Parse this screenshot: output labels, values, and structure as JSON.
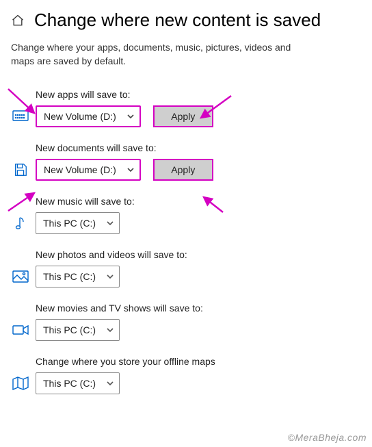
{
  "header": {
    "title": "Change where new content is saved"
  },
  "subtitle": "Change where your apps, documents, music, pictures, videos and maps are saved by default.",
  "sections": {
    "apps": {
      "label": "New apps will save to:",
      "selected": "New Volume (D:)",
      "apply": "Apply"
    },
    "documents": {
      "label": "New documents will save to:",
      "selected": "New Volume (D:)",
      "apply": "Apply"
    },
    "music": {
      "label": "New music will save to:",
      "selected": "This PC (C:)"
    },
    "photos": {
      "label": "New photos and videos will save to:",
      "selected": "This PC (C:)"
    },
    "movies": {
      "label": "New movies and TV shows will save to:",
      "selected": "This PC (C:)"
    },
    "maps": {
      "label": "Change where you store your offline maps",
      "selected": "This PC (C:)"
    }
  },
  "watermark": "©MeraBheja.com",
  "colors": {
    "highlight": "#d400c2",
    "icon": "#0066cc"
  }
}
